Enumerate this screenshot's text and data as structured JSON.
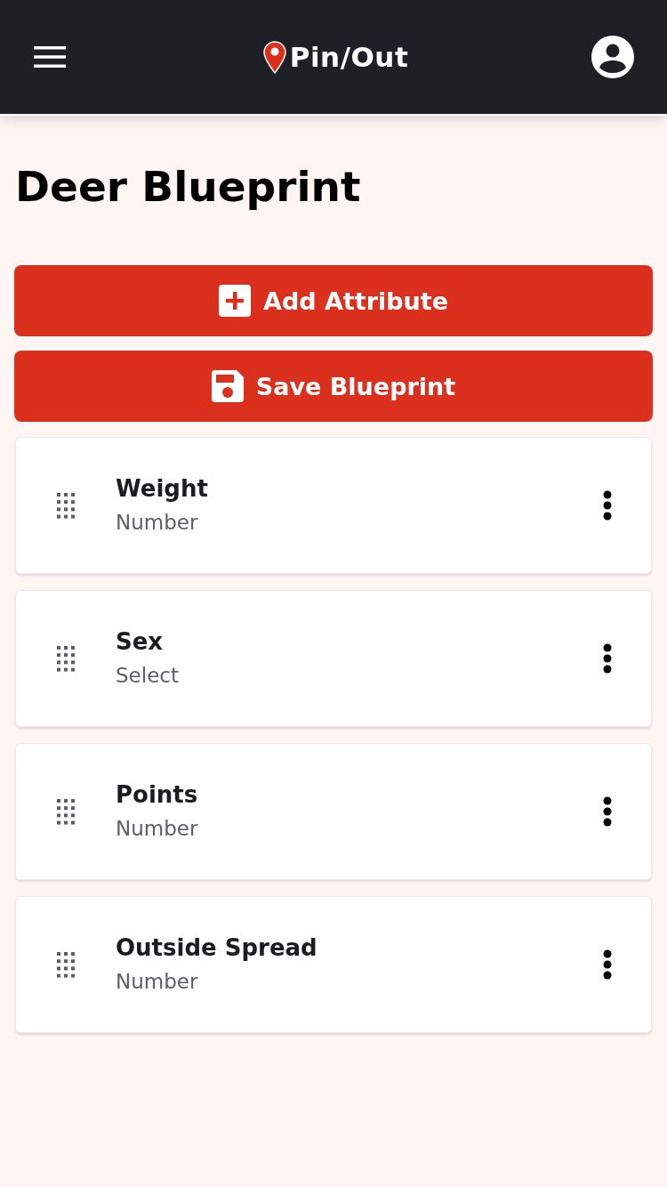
{
  "header": {
    "logo_text": "Pin/Out"
  },
  "page_title": "Deer Blueprint",
  "actions": [
    {
      "label": "Add Attribute",
      "kind": "add"
    },
    {
      "label": "Save Blueprint",
      "kind": "save"
    }
  ],
  "attributes": [
    {
      "name": "Weight",
      "type": "Number"
    },
    {
      "name": "Sex",
      "type": "Select"
    },
    {
      "name": "Points",
      "type": "Number"
    },
    {
      "name": "Outside Spread",
      "type": "Number"
    }
  ]
}
